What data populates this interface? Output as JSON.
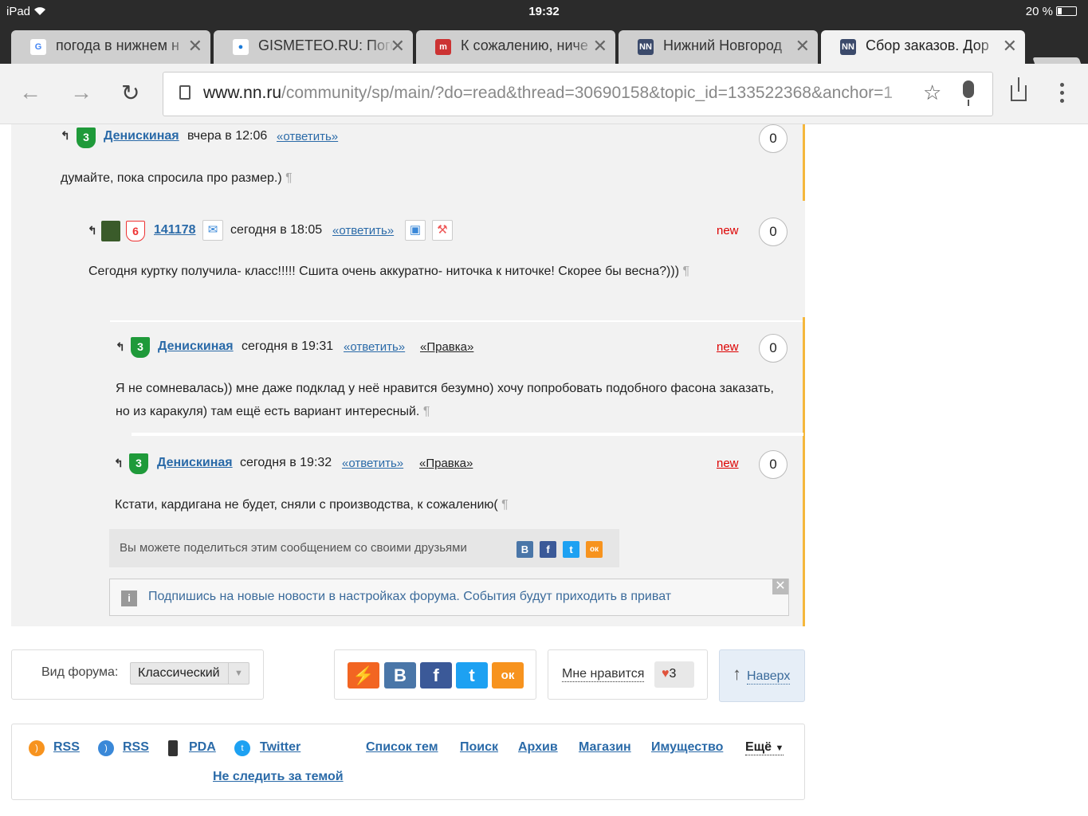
{
  "status_bar": {
    "device": "iPad",
    "time": "19:32",
    "battery": "20 %"
  },
  "tabs": [
    {
      "title": "погода в нижнем н",
      "icon": "google-icon"
    },
    {
      "title": "GISMETEO.RU: Пого",
      "icon": "gismeteo-icon"
    },
    {
      "title": "К сожалению, ниче",
      "icon": "site-icon"
    },
    {
      "title": "Нижний Новгород",
      "icon": "nn-icon"
    },
    {
      "title": "Сбор заказов. Дор",
      "icon": "nn-icon",
      "active": true
    }
  ],
  "toolbar": {
    "url_host": "www.nn.ru",
    "url_path": "/community/sp/main/?do=read&thread=30690158&topic_id=133522368&anchor=1"
  },
  "comments": [
    {
      "level": "3",
      "user": "Денискиная",
      "when": "вчера в 12:06",
      "reply": "«ответить»",
      "count": "0",
      "text": "думайте, пока спросила про размер.)"
    },
    {
      "level": "6",
      "user": "141178",
      "when": "сегодня в 18:05",
      "reply": "«ответить»",
      "new": "new",
      "count": "0",
      "text": "Сегодня куртку получила- класс!!!!! Сшита очень аккуратно- ниточка к ниточке! Скорее бы весна?)))"
    },
    {
      "level": "3",
      "user": "Денискиная",
      "when": "сегодня в 19:31",
      "reply": "«ответить»",
      "edit": "«Правка»",
      "new": "new",
      "count": "0",
      "text_line1": "Я не сомневалась)) мне даже подклад у неё нравится безумно) хочу попробовать подобного фасона заказать,",
      "text_line2": "но из каракуля) там ещё есть вариант интересный."
    },
    {
      "level": "3",
      "user": "Денискиная",
      "when": "сегодня в 19:32",
      "reply": "«ответить»",
      "edit": "«Правка»",
      "new": "new",
      "count": "0",
      "text": "Кстати, кардигана не будет, сняли с производства, к сожалению("
    }
  ],
  "pilcrow": "¶",
  "share": {
    "text": "Вы можете поделиться этим сообщением со своими друзьями",
    "icons": [
      "В",
      "f",
      "t",
      "ок"
    ]
  },
  "notice": {
    "text": "Подпишись на новые новости в настройках форума. События будут приходить в приват",
    "info": "i",
    "close": "✕"
  },
  "forum_view": {
    "label": "Вид форума:",
    "value": "Классический"
  },
  "social_big": [
    "⚡",
    "B",
    "f",
    "t",
    "ок"
  ],
  "like": {
    "label": "Мне нравится",
    "count": "3"
  },
  "up": {
    "label": "Наверх"
  },
  "footer": {
    "links_left": [
      "RSS",
      "RSS",
      "PDA",
      "Twitter"
    ],
    "links_right": [
      "Список тем",
      "Поиск",
      "Архив",
      "Магазин",
      "Имущество"
    ],
    "more": "Ещё",
    "unfollow": "Не следить за темой"
  },
  "colors": {
    "accent": "#f5b73c",
    "link": "#2a6aa8",
    "new": "#dd0000"
  }
}
